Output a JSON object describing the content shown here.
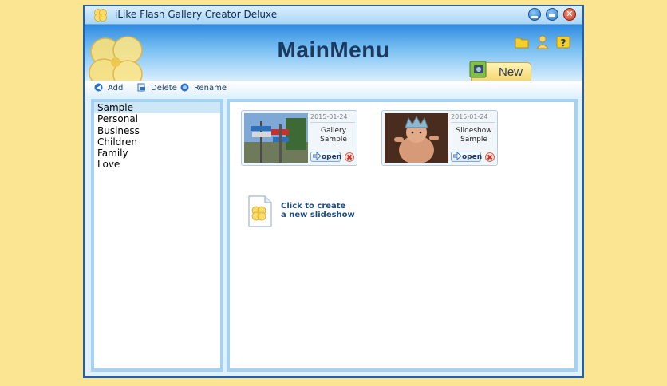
{
  "window": {
    "title": "iLike Flash Gallery Creator Deluxe",
    "icons": [
      "clover-icon",
      "minimize-icon",
      "restore-icon",
      "close-icon"
    ]
  },
  "header": {
    "title": "MainMenu",
    "icons": [
      "folder-icon",
      "user-icon",
      "help-icon"
    ],
    "new_tab_label": "New"
  },
  "toolbar": {
    "add_label": "Add",
    "delete_label": "Delete",
    "rename_label": "Rename"
  },
  "categories": {
    "items": [
      "Sample",
      "Personal",
      "Business",
      "Children",
      "Family",
      "Love"
    ],
    "selected": "Sample"
  },
  "albums": [
    {
      "date": "2015-01-24",
      "name_line1": "Gallery",
      "name_line2": "Sample",
      "open_label": "open",
      "thumbnail": "street-signs-photo"
    },
    {
      "date": "2015-01-24",
      "name_line1": "Slideshow",
      "name_line2": "Sample",
      "open_label": "open",
      "thumbnail": "baby-crown-photo"
    }
  ],
  "create": {
    "line1": "Click to create",
    "line2": "a new slideshow"
  },
  "colors": {
    "desktop": "#fbe593",
    "window_border": "#1f5fb4",
    "panel_border": "#a7d1f0",
    "title_text": "#1c3a60",
    "link_text": "#1e4d84"
  }
}
